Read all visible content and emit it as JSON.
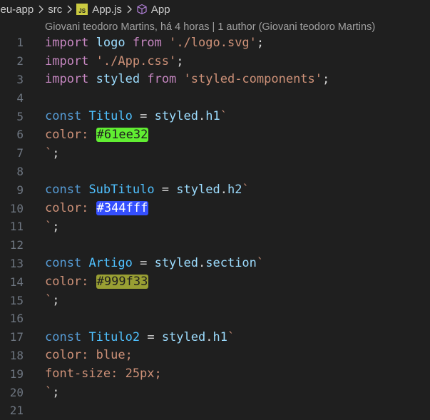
{
  "breadcrumb": {
    "items": [
      "meu-app",
      "src",
      "App.js",
      "App"
    ],
    "js_badge": "JS"
  },
  "blame": "Giovani teodoro Martins, há 4 horas | 1 author (Giovani teodoro Martins)",
  "colors": {
    "swatch_green": "#61ee32",
    "swatch_blue": "#344fff",
    "swatch_olive": "#999f33"
  },
  "lines": [
    {
      "n": "1",
      "tokens": [
        [
          "k",
          "import"
        ],
        [
          "p",
          " "
        ],
        [
          "v",
          "logo"
        ],
        [
          "p",
          " "
        ],
        [
          "k",
          "from"
        ],
        [
          "p",
          " "
        ],
        [
          "s",
          "'./logo.svg'"
        ],
        [
          "p",
          ";"
        ]
      ]
    },
    {
      "n": "2",
      "tokens": [
        [
          "k",
          "import"
        ],
        [
          "p",
          " "
        ],
        [
          "s",
          "'./App.css'"
        ],
        [
          "p",
          ";"
        ]
      ]
    },
    {
      "n": "3",
      "tokens": [
        [
          "k",
          "import"
        ],
        [
          "p",
          " "
        ],
        [
          "v",
          "styled"
        ],
        [
          "p",
          " "
        ],
        [
          "k",
          "from"
        ],
        [
          "p",
          " "
        ],
        [
          "s",
          "'styled-components'"
        ],
        [
          "p",
          ";"
        ]
      ]
    },
    {
      "n": "4",
      "tokens": []
    },
    {
      "n": "5",
      "tokens": [
        [
          "kb",
          "const"
        ],
        [
          "p",
          " "
        ],
        [
          "n",
          "Titulo"
        ],
        [
          "p",
          " = "
        ],
        [
          "v",
          "styled"
        ],
        [
          "p",
          "."
        ],
        [
          "v",
          "h1"
        ],
        [
          "s",
          "`"
        ]
      ]
    },
    {
      "n": "6",
      "tokens": [
        [
          "css-prop",
          "color: "
        ],
        [
          "swatch-green",
          "#61ee32"
        ]
      ]
    },
    {
      "n": "7",
      "tokens": [
        [
          "s",
          "`"
        ],
        [
          "p",
          ";"
        ]
      ]
    },
    {
      "n": "8",
      "tokens": []
    },
    {
      "n": "9",
      "tokens": [
        [
          "kb",
          "const"
        ],
        [
          "p",
          " "
        ],
        [
          "n",
          "SubTitulo"
        ],
        [
          "p",
          " = "
        ],
        [
          "v",
          "styled"
        ],
        [
          "p",
          "."
        ],
        [
          "v",
          "h2"
        ],
        [
          "s",
          "`"
        ]
      ]
    },
    {
      "n": "10",
      "tokens": [
        [
          "css-prop",
          "color: "
        ],
        [
          "swatch-blue",
          "#344fff"
        ]
      ]
    },
    {
      "n": "11",
      "tokens": [
        [
          "s",
          "`"
        ],
        [
          "p",
          ";"
        ]
      ]
    },
    {
      "n": "12",
      "tokens": []
    },
    {
      "n": "13",
      "tokens": [
        [
          "kb",
          "const"
        ],
        [
          "p",
          " "
        ],
        [
          "n",
          "Artigo"
        ],
        [
          "p",
          " = "
        ],
        [
          "v",
          "styled"
        ],
        [
          "p",
          "."
        ],
        [
          "v",
          "section"
        ],
        [
          "s",
          "`"
        ]
      ]
    },
    {
      "n": "14",
      "tokens": [
        [
          "css-prop",
          "color: "
        ],
        [
          "swatch-olive",
          "#999f33"
        ]
      ]
    },
    {
      "n": "15",
      "tokens": [
        [
          "s",
          "`"
        ],
        [
          "p",
          ";"
        ]
      ]
    },
    {
      "n": "16",
      "tokens": []
    },
    {
      "n": "17",
      "tokens": [
        [
          "kb",
          "const"
        ],
        [
          "p",
          " "
        ],
        [
          "n",
          "Titulo2"
        ],
        [
          "p",
          " = "
        ],
        [
          "v",
          "styled"
        ],
        [
          "p",
          "."
        ],
        [
          "v",
          "h1"
        ],
        [
          "s",
          "`"
        ]
      ]
    },
    {
      "n": "18",
      "tokens": [
        [
          "css-prop",
          "color: blue;"
        ]
      ]
    },
    {
      "n": "19",
      "tokens": [
        [
          "css-prop",
          "font-size: 25px;"
        ]
      ]
    },
    {
      "n": "20",
      "tokens": [
        [
          "s",
          "`"
        ],
        [
          "p",
          ";"
        ]
      ]
    },
    {
      "n": "21",
      "tokens": []
    }
  ]
}
